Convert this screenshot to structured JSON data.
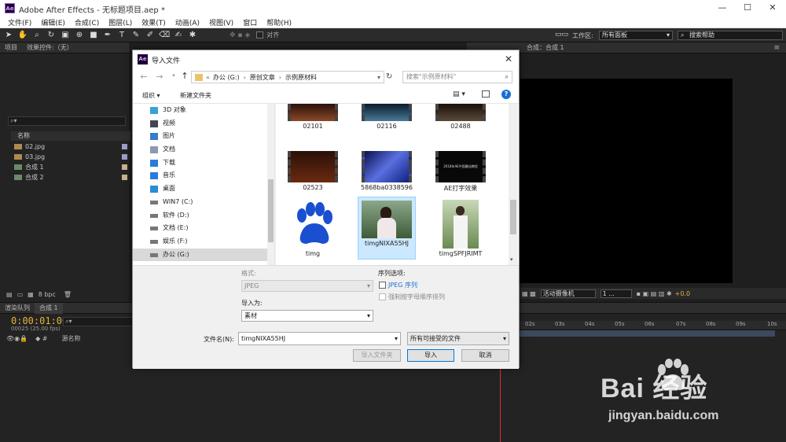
{
  "app": {
    "title": "Adobe After Effects - 无标题项目.aep *",
    "icon": "Ae",
    "menu": [
      "文件(F)",
      "编辑(E)",
      "合成(C)",
      "图层(L)",
      "效果(T)",
      "动画(A)",
      "视图(V)",
      "窗口",
      "帮助(H)"
    ],
    "toolbar": {
      "align_label": "对齐",
      "workspace_label": "工作区:",
      "workspace_value": "所有面板",
      "search_help": "搜索帮助"
    }
  },
  "project_panel": {
    "tabs": [
      "项目",
      "效果控件:（无）"
    ],
    "list_header": "名称",
    "items": [
      {
        "name": "02.jpg",
        "color": "#9aa0c8"
      },
      {
        "name": "03.jpg",
        "color": "#9aa0c8"
      },
      {
        "name": "合成 1",
        "color": "#c8b48a"
      },
      {
        "name": "合成 2",
        "color": "#c8b48a"
      }
    ],
    "bpc": "8 bpc"
  },
  "viewer": {
    "tab": "合成：合成 1",
    "camera": "活动摄像机",
    "views": "1 ...",
    "exposure": "+0.0"
  },
  "timeline": {
    "tabs": [
      "渲染队列",
      "合成 1"
    ],
    "timecode": "0:00:01:00",
    "fps": "00025 (25.00 fps)",
    "col_source": "源名称",
    "ruler": [
      "02s",
      "03s",
      "04s",
      "05s",
      "06s",
      "07s",
      "08s",
      "09s",
      "10s"
    ]
  },
  "dialog": {
    "title": "导入文件",
    "address": [
      "«",
      "办公 (G:)",
      "原创文章",
      "示例原材料"
    ],
    "search_placeholder": "搜索\"示例原材料\"",
    "organize": "组织 ▾",
    "new_folder": "新建文件夹",
    "nav_items": [
      {
        "label": "3D 对象",
        "icon": "cube-icon",
        "color": "#3aa0d8"
      },
      {
        "label": "视频",
        "icon": "video-icon",
        "color": "#445"
      },
      {
        "label": "图片",
        "icon": "picture-icon",
        "color": "#3a7bc8"
      },
      {
        "label": "文档",
        "icon": "document-icon",
        "color": "#8a9ab0"
      },
      {
        "label": "下载",
        "icon": "download-icon",
        "color": "#2a7bd8"
      },
      {
        "label": "音乐",
        "icon": "music-icon",
        "color": "#2a7bd8"
      },
      {
        "label": "桌面",
        "icon": "desktop-icon",
        "color": "#2a8bd8"
      },
      {
        "label": "WIN7 (C:)",
        "icon": "drive-icon",
        "color": "#777"
      },
      {
        "label": "软件 (D:)",
        "icon": "drive-icon",
        "color": "#777"
      },
      {
        "label": "文档 (E:)",
        "icon": "drive-icon",
        "color": "#777"
      },
      {
        "label": "娱乐 (F:)",
        "icon": "drive-icon",
        "color": "#777"
      },
      {
        "label": "办公 (G:)",
        "icon": "drive-icon",
        "color": "#777",
        "selected": true
      }
    ],
    "files": [
      {
        "name": "02101",
        "thumb": "#5a2a1a"
      },
      {
        "name": "02116",
        "thumb": "#1a3a5a"
      },
      {
        "name": "02488",
        "thumb": "#3a2a1a"
      },
      {
        "name": "02523",
        "thumb": "#4a2010"
      },
      {
        "name": "5868ba0338596",
        "thumb": "#2030a0"
      },
      {
        "name": "AE打字效果",
        "thumb": "#080808",
        "thumb_text": "2018年AE中国最佳教程"
      },
      {
        "name": "timg",
        "thumb": "paw"
      },
      {
        "name": "timgNIXA55HJ",
        "thumb": "#6a8a5a",
        "selected": true
      },
      {
        "name": "timgSPFJRIMT",
        "thumb": "#88a878"
      }
    ],
    "format_label": "格式:",
    "format_value": "JPEG",
    "seq_label": "序列选项:",
    "seq_jpeg": "JPEG 序列",
    "force_alpha": "强制按字母顺序排列",
    "import_as_label": "导入为:",
    "import_as_value": "素材",
    "filename_label": "文件名(N):",
    "filename_value": "timgNIXA55HJ",
    "filetype_value": "所有可接受的文件",
    "import_folder_btn": "导入文件夹",
    "import_btn": "导入",
    "cancel_btn": "取消"
  },
  "watermark": {
    "brand": "Bai 经验",
    "url": "jingyan.baidu.com"
  }
}
